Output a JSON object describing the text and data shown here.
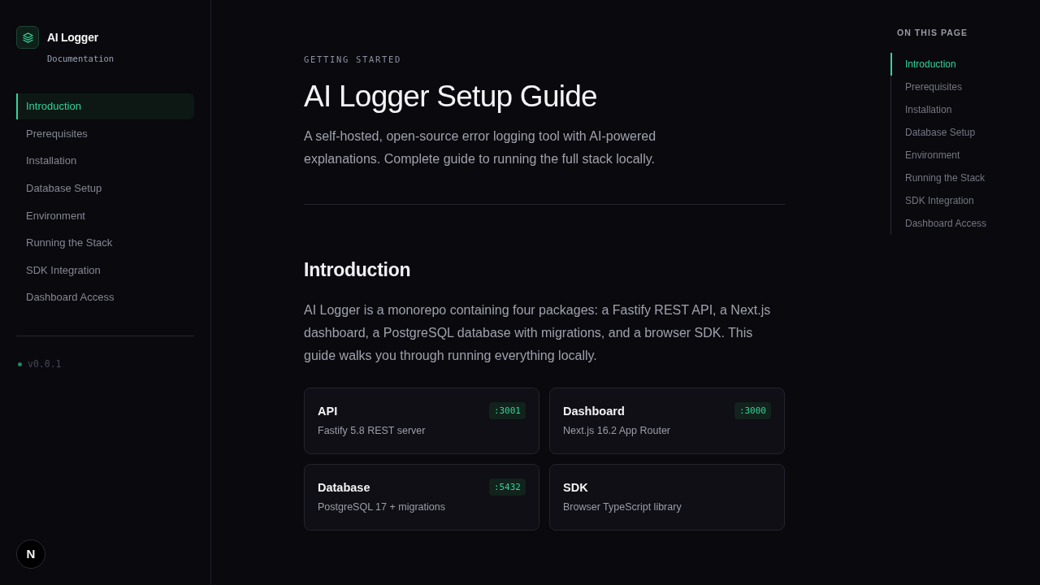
{
  "sidebar": {
    "brand": {
      "title": "AI Logger",
      "subtitle": "Documentation"
    },
    "nav": [
      {
        "label": "Introduction",
        "selected": true
      },
      {
        "label": "Prerequisites",
        "selected": false
      },
      {
        "label": "Installation",
        "selected": false
      },
      {
        "label": "Database Setup",
        "selected": false
      },
      {
        "label": "Environment",
        "selected": false
      },
      {
        "label": "Running the Stack",
        "selected": false
      },
      {
        "label": "SDK Integration",
        "selected": false
      },
      {
        "label": "Dashboard Access",
        "selected": false
      }
    ],
    "version": "v0.0.1"
  },
  "header": {
    "eyebrow": "GETTING STARTED",
    "title": "AI Logger Setup Guide",
    "subtitle": "A self-hosted, open-source error logging tool with AI-powered explanations. Complete guide to running the full stack locally."
  },
  "section": {
    "heading": "Introduction",
    "body": "AI Logger is a monorepo containing four packages: a Fastify REST API, a Next.js dashboard, a PostgreSQL database with migrations, and a browser SDK. This guide walks you through running everything locally.",
    "cards": [
      {
        "title": "API",
        "description": "Fastify 5.8 REST server",
        "port": ":3001"
      },
      {
        "title": "Dashboard",
        "description": "Next.js 16.2 App Router",
        "port": ":3000"
      },
      {
        "title": "Database",
        "description": "PostgreSQL 17 + migrations",
        "port": ":5432"
      },
      {
        "title": "SDK",
        "description": "Browser TypeScript library"
      }
    ]
  },
  "toc": {
    "heading": "ON THIS PAGE",
    "items": [
      {
        "label": "Introduction",
        "selected": true
      },
      {
        "label": "Prerequisites",
        "selected": false
      },
      {
        "label": "Installation",
        "selected": false
      },
      {
        "label": "Database Setup",
        "selected": false
      },
      {
        "label": "Environment",
        "selected": false
      },
      {
        "label": "Running the Stack",
        "selected": false
      },
      {
        "label": "SDK Integration",
        "selected": false
      },
      {
        "label": "Dashboard Access",
        "selected": false
      }
    ]
  },
  "dev_indicator": {
    "label": "N"
  }
}
